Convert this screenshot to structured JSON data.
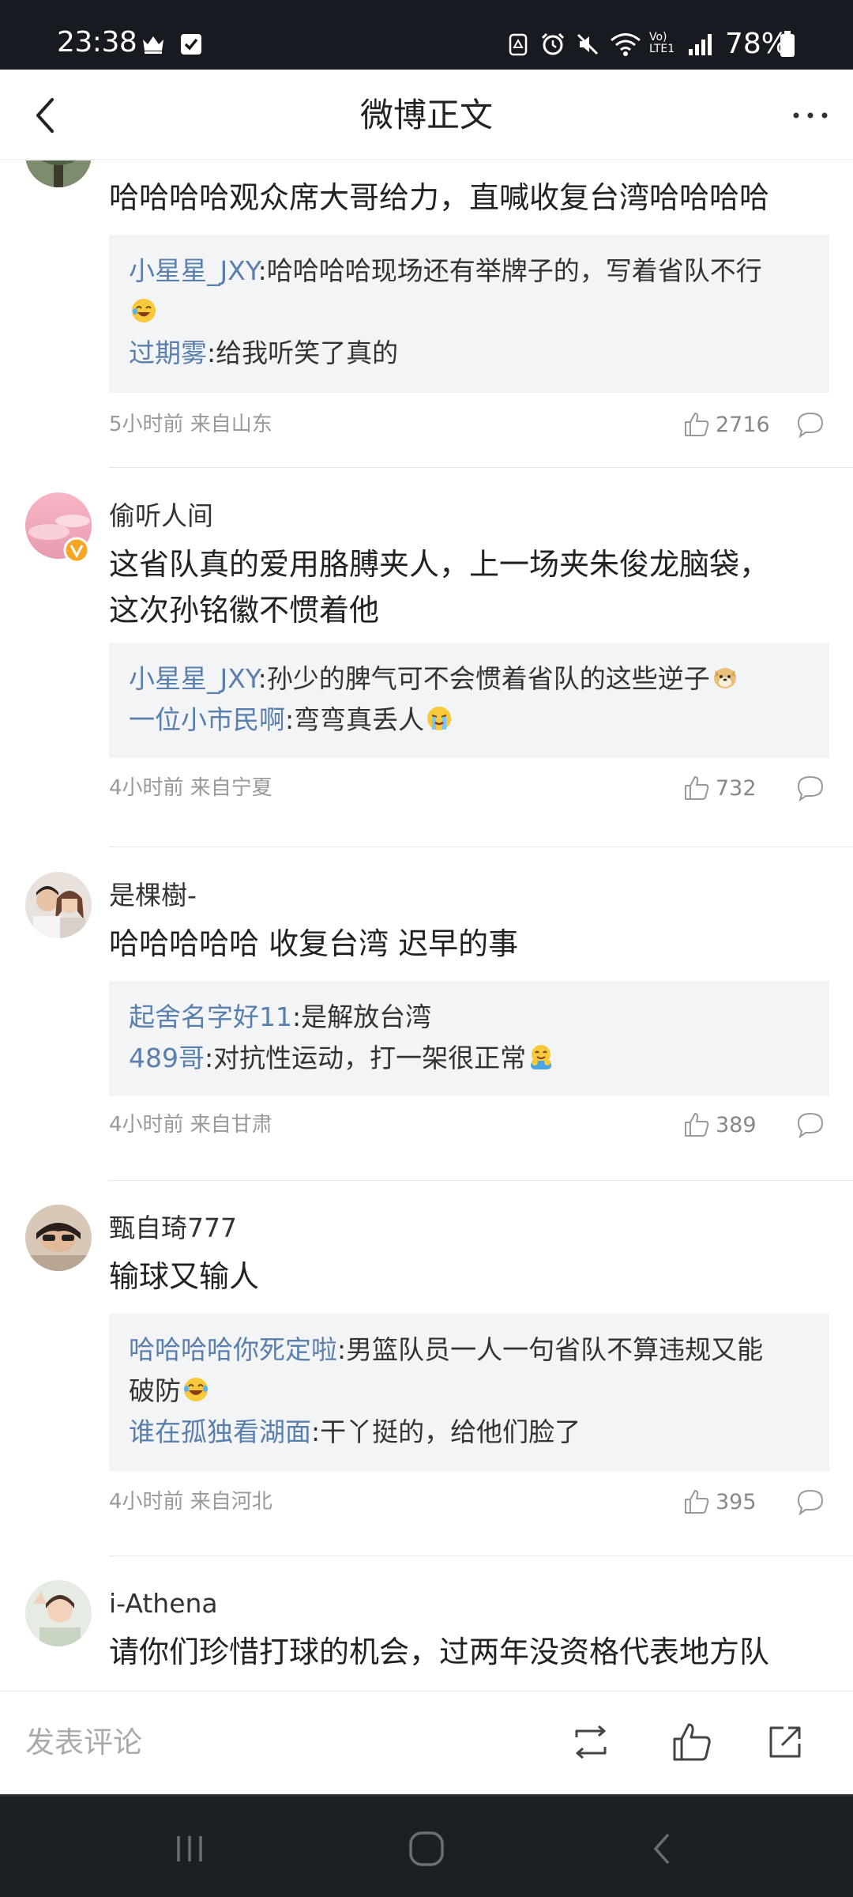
{
  "status_bar": {
    "time": "23:38",
    "battery_text": "78%",
    "icons": [
      "crown-icon",
      "checkbox-icon",
      "nfc-icon",
      "alarm-icon",
      "mute-icon",
      "wifi-icon",
      "volte-icon",
      "signal-icon",
      "battery-icon"
    ],
    "volte_top": "Vo)",
    "volte_bottom": "LTE1"
  },
  "header": {
    "title": "微博正文",
    "back_icon": "chevron-left-icon",
    "more_icon": "more-icon"
  },
  "comments": [
    {
      "username": "",
      "text_lines": [
        "哈哈哈哈观众席大哥给力，直喊收复台湾哈哈哈哈"
      ],
      "replies": [
        {
          "user": "小星星_JXY",
          "text": ":哈哈哈哈现场还有举牌子的，写着省队不行",
          "emoji": "laughing-emoji"
        },
        {
          "user": "过期雾",
          "text": ":给我听笑了真的",
          "emoji": ""
        }
      ],
      "meta": "5小时前 来自山东",
      "likes": "2716"
    },
    {
      "username": "偷听人间",
      "verified": true,
      "text_lines": [
        "这省队真的爱用胳膊夹人，上一场夹朱俊龙脑袋，",
        "这次孙铭徽不惯着他"
      ],
      "replies": [
        {
          "user": "小星星_JXY",
          "text": ":孙少的脾气可不会惯着省队的这些逆子",
          "emoji": "doge-emoji"
        },
        {
          "user": "一位小市民啊",
          "text": ":弯弯真丢人",
          "emoji": "crying-emoji"
        }
      ],
      "meta": "4小时前 来自宁夏",
      "likes": "732"
    },
    {
      "username": "是棵樹-",
      "text_lines": [
        "哈哈哈哈哈 收复台湾 迟早的事"
      ],
      "replies": [
        {
          "user": "起舍名字好11",
          "text": ":是解放台湾",
          "emoji": ""
        },
        {
          "user": "489哥",
          "text": ":对抗性运动，打一架很正常",
          "emoji": "hug-emoji"
        }
      ],
      "meta": "4小时前 来自甘肃",
      "likes": "389"
    },
    {
      "username": "甄自琦777",
      "text_lines": [
        "输球又输人"
      ],
      "replies": [
        {
          "user": "哈哈哈哈你死定啦",
          "text": ":男篮队员一人一句省队不算违规又能",
          "text2": "破防",
          "emoji": "laughing-tears-emoji"
        },
        {
          "user": "谁在孤独看湖面",
          "text": ":干丫挺的，给他们脸了",
          "emoji": ""
        }
      ],
      "meta": "4小时前 来自河北",
      "likes": "395"
    },
    {
      "username": "i-Athena",
      "text_lines": [
        "请你们珍惜打球的机会，过两年没资格代表地方队"
      ]
    }
  ],
  "bottom_bar": {
    "comment_placeholder": "发表评论",
    "icons": [
      "repost-icon",
      "like-icon",
      "share-icon"
    ]
  },
  "nav_bar": {
    "icons": [
      "recent-apps-icon",
      "home-icon",
      "back-icon"
    ]
  },
  "colors": {
    "status_bar_bg": "#171a21",
    "reply_user": "#5a7fad",
    "reply_bg": "#f3f4f6",
    "meta_text": "#999999",
    "nav_bg": "#1c1f24"
  }
}
